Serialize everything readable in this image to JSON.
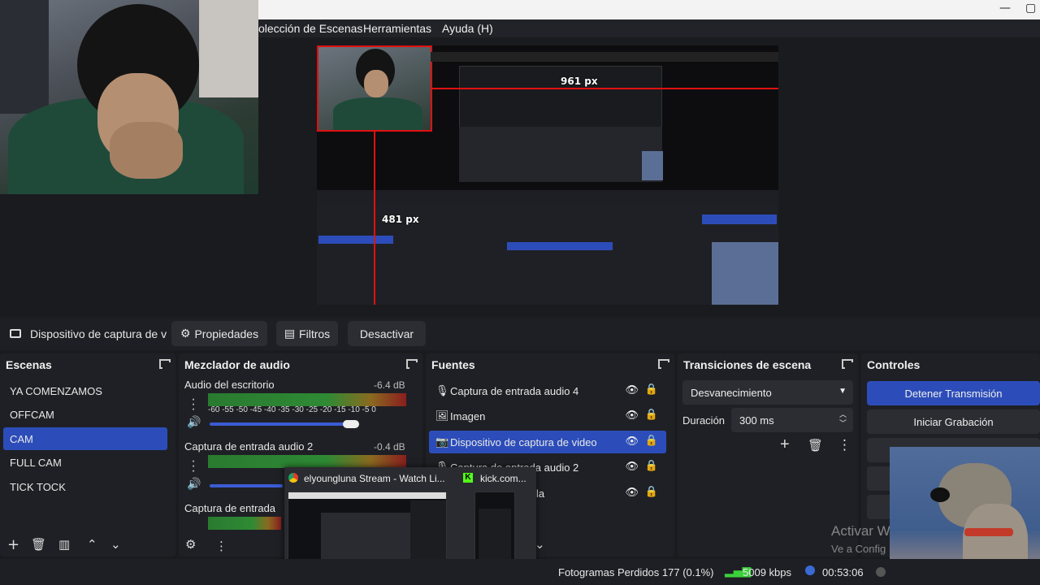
{
  "menu": {
    "scene_collection": "olección de Escenas",
    "tools": "Herramientas",
    "help": "Ayuda (H)"
  },
  "preview": {
    "label_top": "961 px",
    "label_left": "481 px"
  },
  "source_toolbar": {
    "device_name": "Dispositivo de captura de v",
    "properties": "Propiedades",
    "filters": "Filtros",
    "deactivate": "Desactivar"
  },
  "scenes": {
    "title": "Escenas",
    "items": [
      "YA COMENZAMOS",
      "OFFCAM",
      "CAM",
      "FULL CAM",
      "TICK TOCK"
    ],
    "selected": "CAM"
  },
  "mixer": {
    "title": "Mezclador de audio",
    "tracks": [
      {
        "name": "Audio del escritorio",
        "db": "-6.4 dB"
      },
      {
        "name": "Captura de entrada audio 2",
        "db": "-0.4 dB"
      },
      {
        "name": "Captura de entrada",
        "db": ""
      }
    ],
    "ticks": "-60 -55 -50 -45 -40 -35 -30 -25 -20 -15 -10 -5 0"
  },
  "sources": {
    "title": "Fuentes",
    "items": [
      {
        "label": "Captura de entrada audio 4",
        "icon": "mic-icon"
      },
      {
        "label": "Imagen",
        "icon": "image-icon"
      },
      {
        "label": "Dispositivo de captura de video",
        "icon": "camera-icon"
      },
      {
        "label": "Captura de entrada audio 2",
        "icon": "mic-icon"
      },
      {
        "label": "la",
        "icon": "mic-icon"
      }
    ]
  },
  "transitions": {
    "title": "Transiciones de escena",
    "type": "Desvanecimiento",
    "duration_label": "Duración",
    "duration_value": "300 ms"
  },
  "controls": {
    "title": "Controles",
    "stop_stream": "Detener Transmisión",
    "start_recording": "Iniciar Grabación"
  },
  "taskbar_popup": {
    "chrome_title": "elyoungluna Stream - Watch Li...",
    "kick_title": "kick.com..."
  },
  "status": {
    "dropped_frames": "Fotogramas Perdidos 177 (0.1%)",
    "bitrate": "5009 kbps",
    "time": "00:53:06"
  },
  "watermark": {
    "line1": "Activar W",
    "line2": "Ve a Config"
  },
  "colors": {
    "accent": "#2c4db9",
    "red_guides": "#e01010",
    "dock_bg": "#1f2025"
  }
}
